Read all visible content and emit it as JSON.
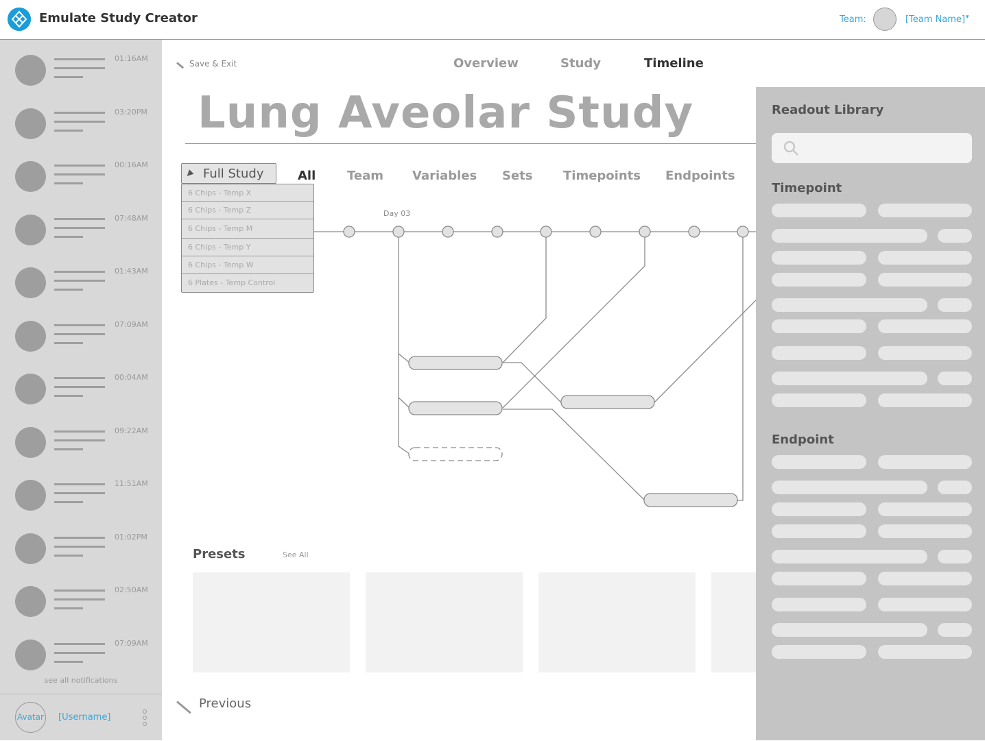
{
  "header": {
    "app_title": "Emulate Study Creator",
    "team_label": "Team:",
    "team_name": "[Team Name]"
  },
  "sidebar": {
    "notifications": [
      {
        "time": "01:16AM"
      },
      {
        "time": "03:20PM"
      },
      {
        "time": "00:16AM"
      },
      {
        "time": "07:48AM"
      },
      {
        "time": "01:43AM"
      },
      {
        "time": "07:09AM"
      },
      {
        "time": "00:04AM"
      },
      {
        "time": "09:22AM"
      },
      {
        "time": "11:51AM"
      },
      {
        "time": "01:02PM"
      },
      {
        "time": "02:50AM"
      },
      {
        "time": "07:09AM"
      }
    ],
    "see_all": "see all notifications",
    "user": {
      "avatar": "Avatar",
      "username": "[Username]"
    }
  },
  "toolbar": {
    "save_exit": "Save & Exit"
  },
  "nav_tabs": [
    {
      "label": "Overview",
      "active": false
    },
    {
      "label": "Study",
      "active": false
    },
    {
      "label": "Timeline",
      "active": true
    }
  ],
  "page_title": "Lung Aveolar Study",
  "study_select": {
    "value": "Full Study",
    "options": [
      "6 Chips - Temp X",
      "6 Chips - Temp Z",
      "6 Chips - Temp M",
      "6 Chips - Temp Y",
      "6 Chips - Temp W",
      "6 Plates - Temp Control"
    ]
  },
  "filter_tabs": [
    {
      "label": "All",
      "active": true
    },
    {
      "label": "Team",
      "active": false
    },
    {
      "label": "Variables",
      "active": false
    },
    {
      "label": "Sets",
      "active": false
    },
    {
      "label": "Timepoints",
      "active": false
    },
    {
      "label": "Endpoints",
      "active": false
    }
  ],
  "timeline": {
    "day_label": "Day 03"
  },
  "presets": {
    "title": "Presets",
    "see_all": "See All"
  },
  "footer": {
    "previous": "Previous"
  },
  "library": {
    "title": "Readout Library",
    "search_placeholder": "",
    "sections": [
      {
        "title": "Timepoint"
      },
      {
        "title": "Endpoint"
      }
    ]
  },
  "colors": {
    "accent": "#1a9dd9",
    "link": "#3aa7d8",
    "sidebar_bg": "#d8d8d8",
    "panel_bg": "#c4c4c4"
  }
}
